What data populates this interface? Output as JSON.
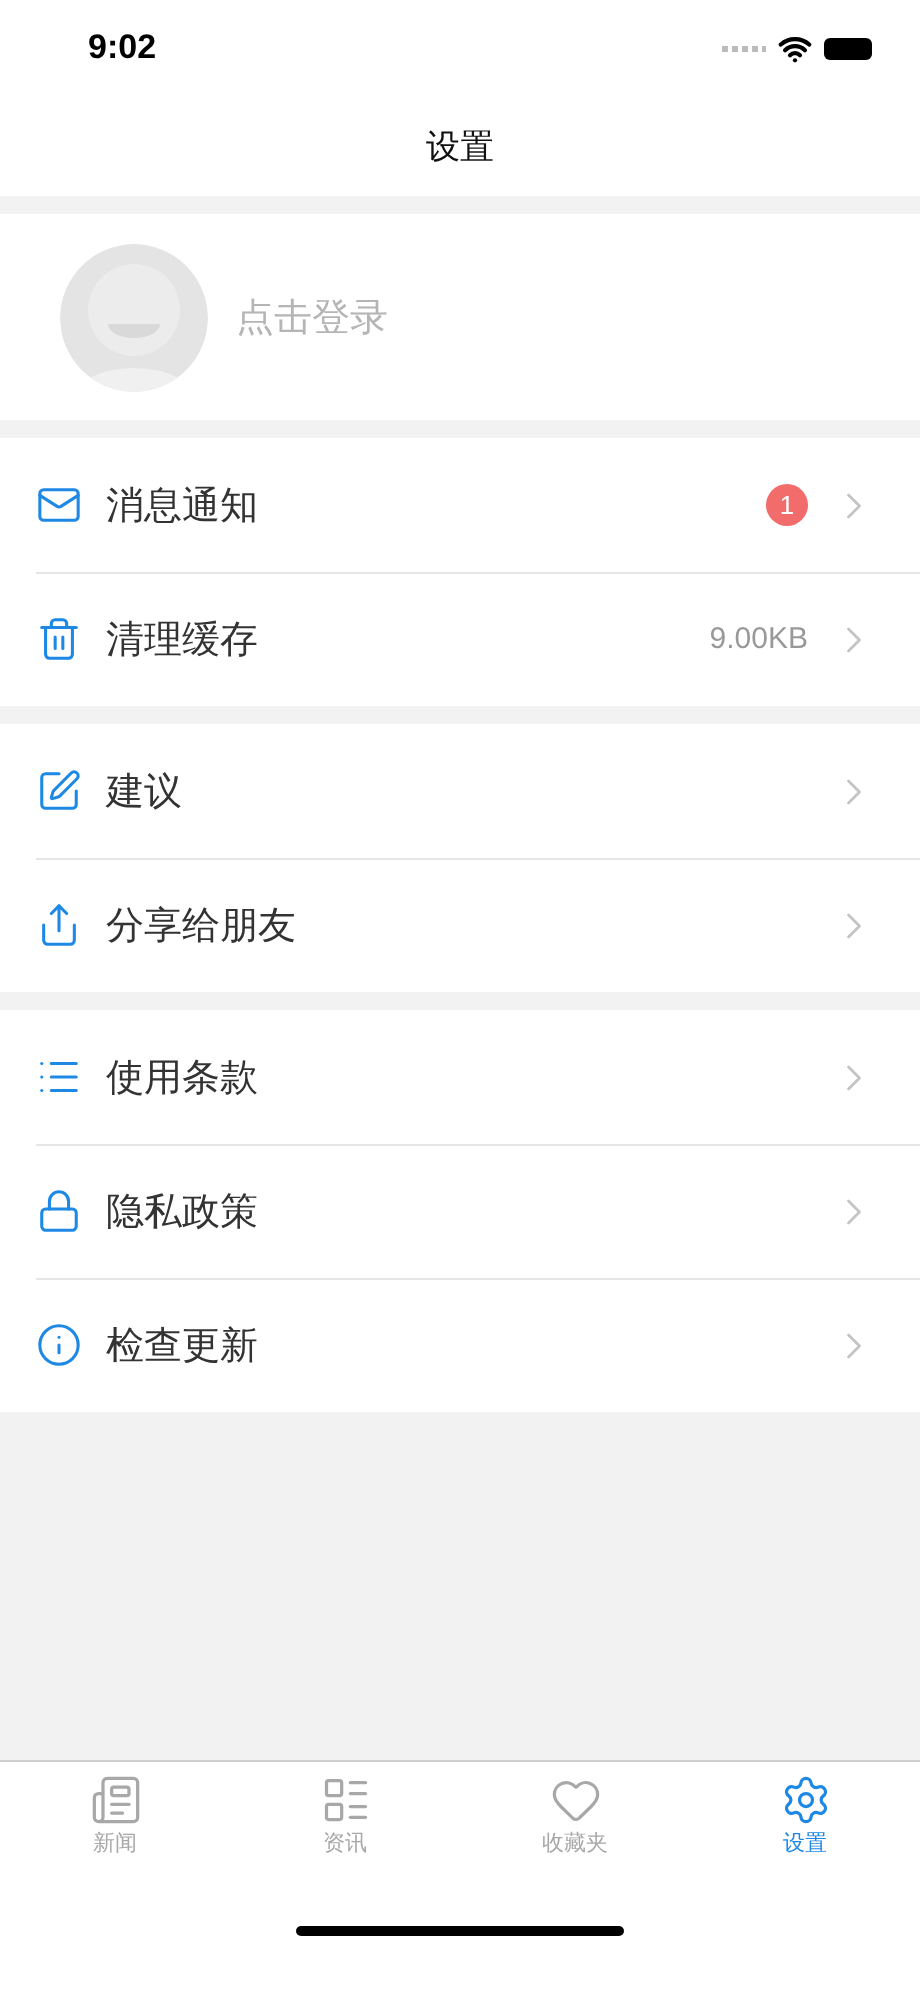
{
  "status_bar": {
    "time": "9:02"
  },
  "nav": {
    "title": "设置"
  },
  "profile": {
    "login": "点击登录"
  },
  "groups": [
    [
      {
        "kind": "mail",
        "label": "消息通知",
        "badge": "1"
      },
      {
        "kind": "trash",
        "label": "清理缓存",
        "value": "9.00KB"
      }
    ],
    [
      {
        "kind": "edit",
        "label": "建议"
      },
      {
        "kind": "share",
        "label": "分享给朋友"
      }
    ],
    [
      {
        "kind": "list",
        "label": "使用条款"
      },
      {
        "kind": "lock",
        "label": "隐私政策"
      },
      {
        "kind": "info",
        "label": "检查更新"
      }
    ]
  ],
  "tabs": [
    {
      "kind": "news",
      "label": "新闻",
      "selected": false
    },
    {
      "kind": "newspaper",
      "label": "资讯",
      "selected": false
    },
    {
      "kind": "heart",
      "label": "收藏夹",
      "selected": false
    },
    {
      "kind": "settings",
      "label": "设置",
      "selected": true
    }
  ]
}
